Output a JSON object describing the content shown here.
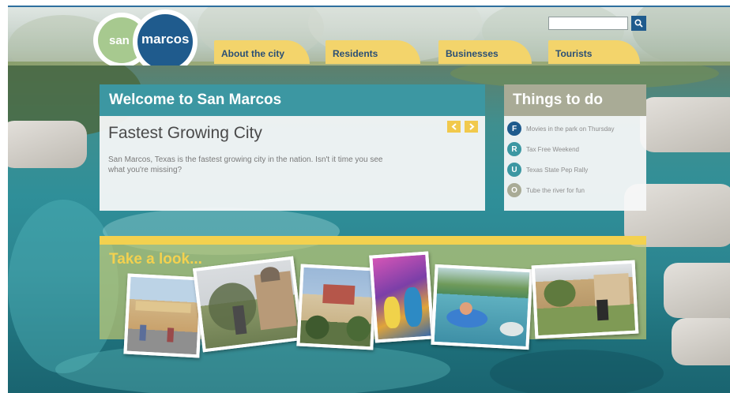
{
  "site": {
    "logo": {
      "word1": "san",
      "word2": "marcos"
    },
    "search": {
      "value": "",
      "placeholder": "",
      "icon": "search-icon"
    }
  },
  "nav": [
    {
      "label": "About the city"
    },
    {
      "label": "Residents"
    },
    {
      "label": "Businesses"
    },
    {
      "label": "Tourists"
    }
  ],
  "welcome": {
    "heading": "Welcome to San Marcos",
    "feature_title": "Fastest Growing City",
    "description": "San Marcos, Texas is the fastest growing city in the nation. Isn't it time you see what you're missing?",
    "prev_icon": "chevron-left-icon",
    "next_icon": "chevron-right-icon"
  },
  "things_to_do": {
    "heading": "Things to do",
    "items": [
      {
        "letter": "F",
        "text": "Movies in the park on Thursday",
        "color": "#1f5b8d"
      },
      {
        "letter": "R",
        "text": "Tax Free Weekend",
        "color": "#3c97a2"
      },
      {
        "letter": "U",
        "text": "Texas State Pep Rally",
        "color": "#3c97a2"
      },
      {
        "letter": "O",
        "text": "Tube the river for fun",
        "color": "#a9ab96"
      }
    ]
  },
  "take_a_look": {
    "heading": "Take a look...",
    "photos": [
      {
        "subject": "shopping-outlet"
      },
      {
        "subject": "courthouse-statue"
      },
      {
        "subject": "university-building"
      },
      {
        "subject": "costumed-performers"
      },
      {
        "subject": "river-tubing"
      },
      {
        "subject": "town-square"
      }
    ]
  },
  "colors": {
    "teal": "#3c97a2",
    "navy": "#1f5b8d",
    "gold": "#f3d14f",
    "tab": "#f3d46b",
    "grey_olive": "#a9ab96",
    "logo_green": "#a7c98f"
  }
}
